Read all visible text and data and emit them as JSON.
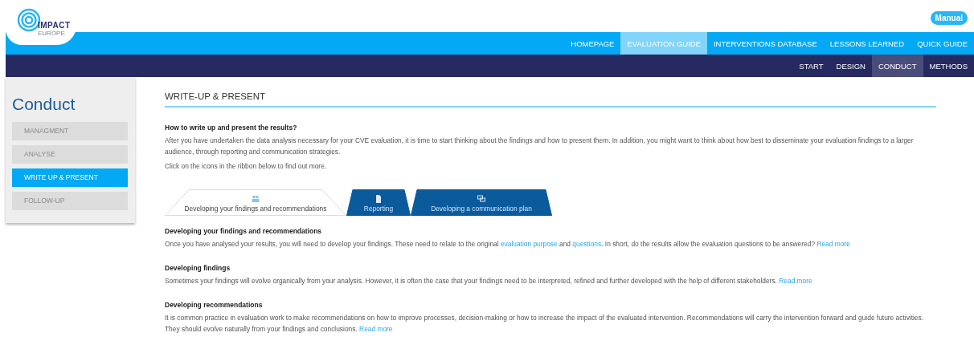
{
  "logo": {
    "name": "IMPACT",
    "subtitle": "EUROPE"
  },
  "manual_button": "Manual",
  "main_nav": [
    {
      "label": "HOMEPAGE",
      "selected": false
    },
    {
      "label": "EVALUATION GUIDE",
      "selected": true
    },
    {
      "label": "INTERVENTIONS DATABASE",
      "selected": false
    },
    {
      "label": "LESSONS LEARNED",
      "selected": false
    },
    {
      "label": "QUICK GUIDE",
      "selected": false
    }
  ],
  "sub_nav": [
    {
      "label": "START",
      "selected": false
    },
    {
      "label": "DESIGN",
      "selected": false
    },
    {
      "label": "CONDUCT",
      "selected": true
    },
    {
      "label": "METHODS",
      "selected": false
    }
  ],
  "sidebar": {
    "title": "Conduct",
    "items": [
      {
        "label": "MANAGMENT",
        "selected": false
      },
      {
        "label": "ANALYSE",
        "selected": false
      },
      {
        "label": "WRITE UP & PRESENT",
        "selected": true
      },
      {
        "label": "FOLLOW-UP",
        "selected": false
      }
    ]
  },
  "page_title": "WRITE-UP & PRESENT",
  "intro": {
    "heading": "How to write up and present the results?",
    "paragraphs": [
      "After you have undertaken the data analysis necessary for your CVE evaluation, it is time to start thinking about the findings and how to present them. In addition, you might want to think about how best to disseminate your evaluation findings to a larger audience, through reporting and communication strategies.",
      "Click on the icons in the ribbon below to find out more."
    ]
  },
  "ribbon": [
    {
      "label": "Developing your findings and recommendations",
      "selected": true
    },
    {
      "label": "Reporting",
      "selected": false
    },
    {
      "label": "Developing a communication plan",
      "selected": false
    }
  ],
  "sections": [
    {
      "heading": "Developing your findings and recommendations",
      "parts": [
        {
          "kind": "text",
          "text": "Once you have analysed your results, you will need to develop your findings. These need to relate to the original "
        },
        {
          "kind": "link",
          "text": "evaluation purpose"
        },
        {
          "kind": "text",
          "text": " and "
        },
        {
          "kind": "link",
          "text": "questions"
        },
        {
          "kind": "text",
          "text": ". In short, do the results allow the evaluation questions to be answered? "
        },
        {
          "kind": "link",
          "text": "Read more"
        }
      ]
    },
    {
      "heading": "Developing findings",
      "parts": [
        {
          "kind": "text",
          "text": "Sometimes your findings will evolve organically from your analysis. However, it is often the case that your findings need to be interpreted, refined and further developed with the help of different stakeholders. "
        },
        {
          "kind": "link",
          "text": "Read more"
        }
      ]
    },
    {
      "heading": "Developing recommendations",
      "parts": [
        {
          "kind": "text",
          "text": "It is common practice in evaluation work to make recommendations on how to improve processes, decision-making or how to increase the impact of the evaluated intervention. Recommendations will carry the intervention forward and guide future activities. They should evolve naturally from your findings and conclusions. "
        },
        {
          "kind": "link",
          "text": "Read more"
        }
      ]
    }
  ]
}
